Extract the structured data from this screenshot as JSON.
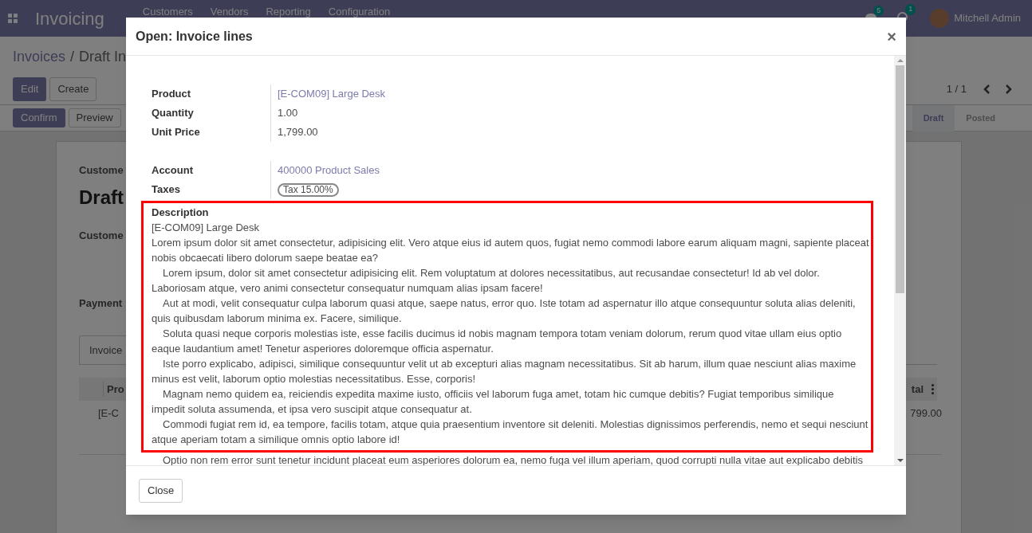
{
  "navbar": {
    "app_title": "Invoicing",
    "menu": [
      "Customers",
      "Vendors",
      "Reporting",
      "Configuration"
    ],
    "messages_count": "5",
    "activities_count": "1",
    "user": "Mitchell Admin"
  },
  "control_panel": {
    "breadcrumb": [
      {
        "label": "Invoices"
      },
      {
        "label": "Draft In"
      }
    ],
    "breadcrumb_separator": "/",
    "buttons": [
      "Edit",
      "Create"
    ],
    "pager": "1 / 1"
  },
  "status_bar": {
    "buttons": [
      "Confirm",
      "Preview"
    ],
    "stages": [
      {
        "label": "Draft",
        "selected": true
      },
      {
        "label": "Posted",
        "selected": false
      }
    ]
  },
  "sheet": {
    "label_1": "Custome",
    "title": "Draft",
    "label_2": "Custome",
    "label_3": "Payment",
    "tab": "Invoice",
    "column_1": "Pro",
    "column_2": "tal",
    "cell_1": "[E-C",
    "cell_2": "799.00"
  },
  "dialog": {
    "title": "Open: Invoice lines",
    "close_symbol": "×",
    "fields_1": [
      {
        "label": "Product",
        "value": "[E-COM09] Large Desk",
        "kind": "link"
      },
      {
        "label": "Quantity",
        "value": "1.00",
        "kind": "text"
      },
      {
        "label": "Unit Price",
        "value": "1,799.00",
        "kind": "text"
      }
    ],
    "fields_2": [
      {
        "label": "Account",
        "value": "400000 Product Sales",
        "kind": "link"
      },
      {
        "label": "Taxes",
        "value": "Tax 15.00%",
        "kind": "tag"
      }
    ],
    "description": {
      "label": "Description",
      "first_line": "[E-COM09] Large Desk",
      "paragraphs": [
        "Lorem ipsum dolor sit amet consectetur, adipisicing elit. Vero atque eius id autem quos, fugiat nemo commodi labore earum aliquam magni, sapiente placeat nobis obcaecati libero dolorum saepe beatae ea?",
        "Lorem ipsum, dolor sit amet consectetur adipisicing elit. Rem voluptatum at dolores necessitatibus, aut recusandae consectetur! Id ab vel dolor. Laboriosam atque, vero animi consectetur consequatur numquam alias ipsam facere!",
        "Aut at modi, velit consequatur culpa laborum quasi atque, saepe natus, error quo. Iste totam ad aspernatur illo atque consequuntur soluta alias deleniti, quis quibusdam laborum minima ex. Facere, similique.",
        "Soluta quasi neque corporis molestias iste, esse facilis ducimus id nobis magnam tempora totam veniam dolorum, rerum quod vitae ullam eius optio eaque laudantium amet! Tenetur asperiores doloremque officia aspernatur.",
        "Iste porro explicabo, adipisci, similique consequuntur velit ut ab excepturi alias magnam necessitatibus. Sit ab harum, illum quae nesciunt alias maxime minus est velit, laborum optio molestias necessitatibus. Esse, corporis!",
        "Magnam nemo quidem ea, reiciendis expedita maxime iusto, officiis vel laborum fuga amet, totam hic cumque debitis? Fugiat temporibus similique impedit soluta assumenda, et ipsa vero suscipit atque consequatur at.",
        "Commodi fugiat rem id, ea tempore, facilis totam, atque quia praesentium inventore sit deleniti. Molestias dignissimos perferendis, nemo et sequi nesciunt atque aperiam totam a similique omnis optio labore id!",
        "Optio non rem error sunt tenetur incidunt placeat eum asperiores dolorum ea, nemo fuga vel illum aperiam, quod corrupti nulla vitae aut explicabo debitis"
      ]
    },
    "footer_button": "Close"
  }
}
